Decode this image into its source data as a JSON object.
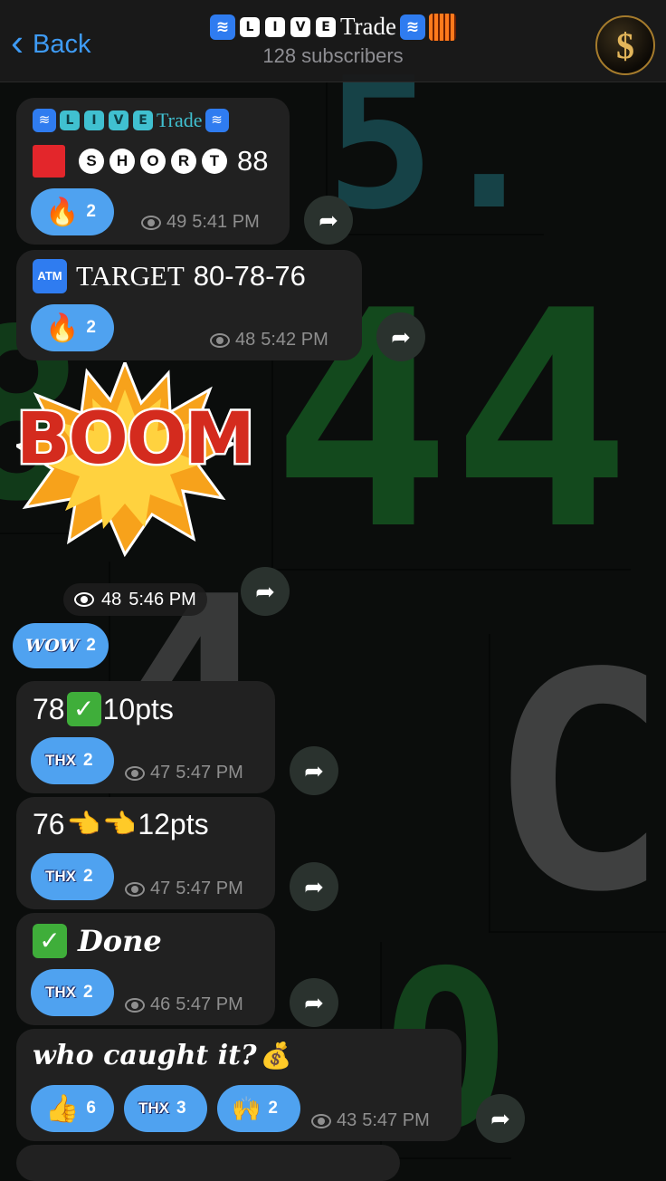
{
  "header": {
    "back_label": "Back",
    "title_letters": [
      "L",
      "I",
      "V",
      "E"
    ],
    "title_word": "Trade",
    "subscribers": "128 subscribers",
    "avatar_glyph": "$"
  },
  "messages": [
    {
      "id": "m1",
      "line1_letters": [
        "L",
        "I",
        "V",
        "E"
      ],
      "line1_word": "Trade",
      "line2_letters": [
        "S",
        "H",
        "O",
        "R",
        "T"
      ],
      "line2_number": "88",
      "reactions": [
        {
          "emoji": "🔥",
          "count": "2"
        }
      ],
      "views": "49",
      "time": "5:41 PM"
    },
    {
      "id": "m2",
      "atm_label": "ATM",
      "target_word": "TARGET",
      "target_value": "80-78-76",
      "reactions": [
        {
          "emoji": "🔥",
          "count": "2"
        }
      ],
      "views": "48",
      "time": "5:42 PM"
    },
    {
      "id": "m3",
      "sticker_text": "BOOM",
      "views": "48",
      "time": "5:46 PM",
      "reactions": [
        {
          "emoji": "WOW",
          "count": "2"
        }
      ]
    },
    {
      "id": "m4",
      "text_pre": "78",
      "text_post": "10pts",
      "reactions": [
        {
          "emoji": "THX",
          "count": "2"
        }
      ],
      "views": "47",
      "time": "5:47 PM"
    },
    {
      "id": "m5",
      "text_pre": "76",
      "text_post": "12pts",
      "reactions": [
        {
          "emoji": "THX",
          "count": "2"
        }
      ],
      "views": "47",
      "time": "5:47 PM"
    },
    {
      "id": "m6",
      "text": "Done",
      "reactions": [
        {
          "emoji": "THX",
          "count": "2"
        }
      ],
      "views": "46",
      "time": "5:47 PM"
    },
    {
      "id": "m7",
      "text": "who caught it?",
      "reactions": [
        {
          "emoji": "👍",
          "count": "6"
        },
        {
          "emoji": "THX",
          "count": "3"
        },
        {
          "emoji": "🙌",
          "count": "2"
        }
      ],
      "views": "43",
      "time": "5:47 PM"
    }
  ],
  "colors": {
    "accent": "#3e9bf5",
    "bubble": "#212121",
    "reaction": "#4fa2f0",
    "background": "#0b0d0c"
  }
}
